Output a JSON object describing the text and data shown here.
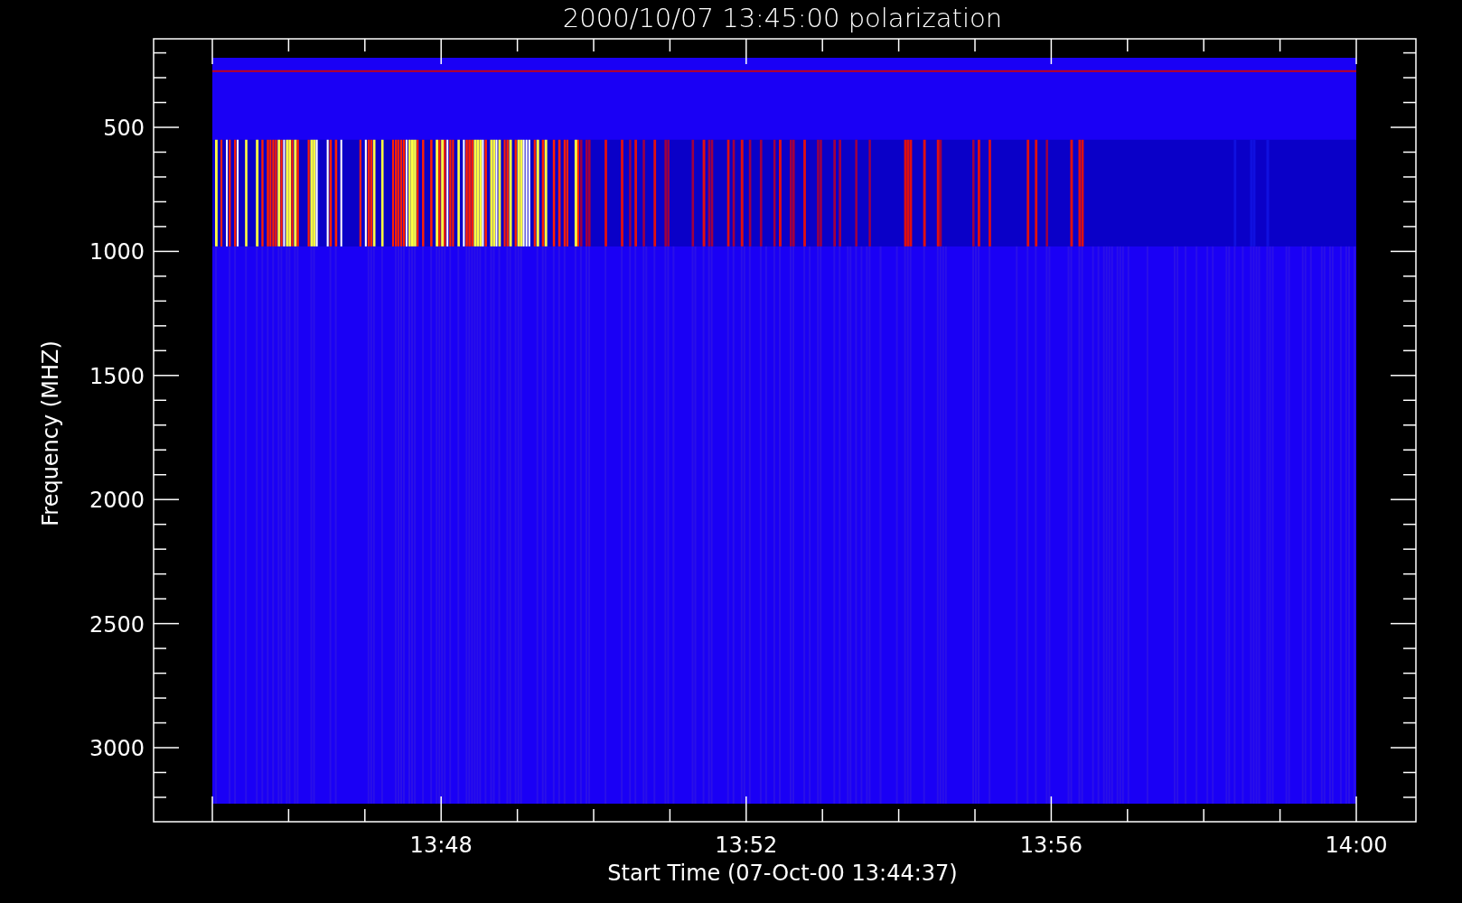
{
  "title": "2000/10/07 13:45:00 polarization",
  "y_axis": {
    "label": "Frequency (MHZ)",
    "ticks": [
      "500",
      "1000",
      "1500",
      "2000",
      "2500",
      "3000"
    ]
  },
  "x_axis": {
    "label": "Start Time (07-Oct-00 13:44:37)",
    "ticks": [
      "13:48",
      "13:52",
      "13:56",
      "14:00"
    ]
  }
}
